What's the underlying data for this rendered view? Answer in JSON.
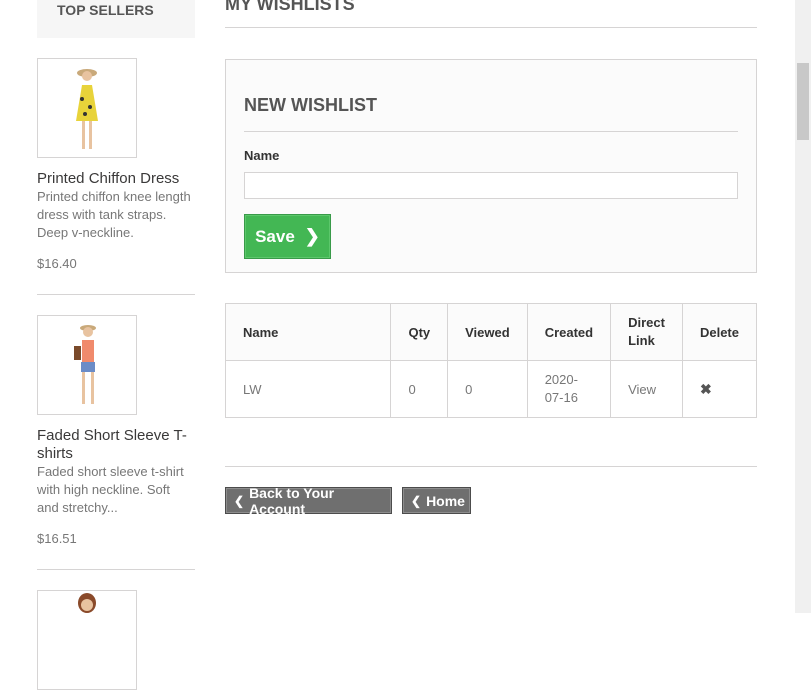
{
  "sidebar": {
    "title": "TOP SELLERS",
    "products": [
      {
        "name": "Printed Chiffon Dress",
        "description": "Printed chiffon knee length dress with tank straps. Deep v-neckline.",
        "price": "$16.40"
      },
      {
        "name": "Faded Short Sleeve T-shirts",
        "description": "Faded short sleeve t-shirt with high neckline. Soft and stretchy...",
        "price": "$16.51"
      }
    ]
  },
  "page": {
    "heading": "MY WISHLISTS"
  },
  "new_wishlist": {
    "title": "NEW WISHLIST",
    "name_label": "Name",
    "name_value": "",
    "save_label": "Save"
  },
  "table": {
    "headers": [
      "Name",
      "Qty",
      "Viewed",
      "Created",
      "Direct Link",
      "Delete"
    ],
    "rows": [
      {
        "name": "LW",
        "qty": "0",
        "viewed": "0",
        "created": "2020-07-16",
        "link": "View"
      }
    ]
  },
  "footer": {
    "back_label": "Back to Your Account",
    "home_label": "Home"
  },
  "colors": {
    "save_green": "#43b754",
    "gray_button": "#6f6f6f"
  }
}
